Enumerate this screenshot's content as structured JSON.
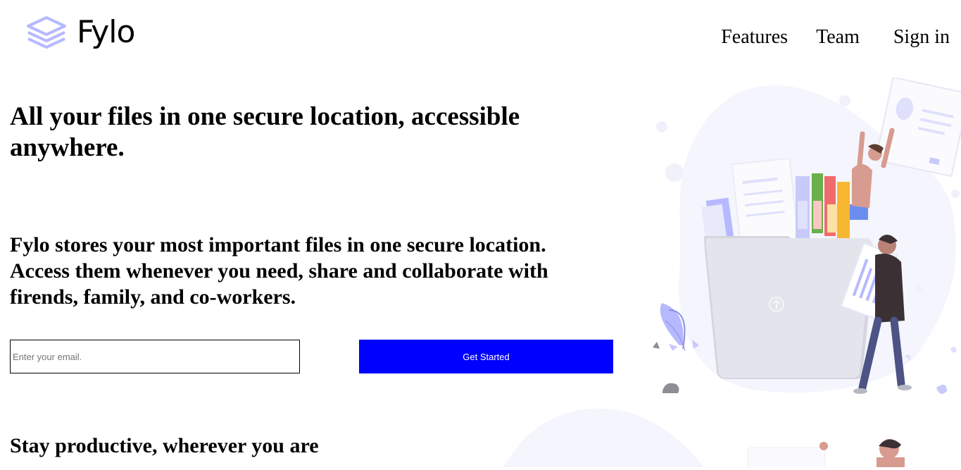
{
  "header": {
    "brand": "Fylo",
    "logo_icon": "stacked-layers-icon",
    "nav": [
      {
        "label": "Features"
      },
      {
        "label": "Team"
      },
      {
        "label": "Sign in"
      }
    ]
  },
  "hero": {
    "title": "All your files in one secure location, accessible anywhere.",
    "description": "Fylo stores your most important files in one secure location. Access them whenever you need, share and collaborate with firends, family, and co-workers.",
    "email_placeholder": "Enter your email.",
    "cta_label": "Get Started",
    "illustration": "person-uploading-files-to-folder-illustration"
  },
  "productive": {
    "title": "Stay productive, wherever you are",
    "illustration": "person-working-illustration"
  },
  "colors": {
    "cta": "#0000ff",
    "logo": "#b6b9ff",
    "illustration_bg": "#f4f5fd"
  }
}
